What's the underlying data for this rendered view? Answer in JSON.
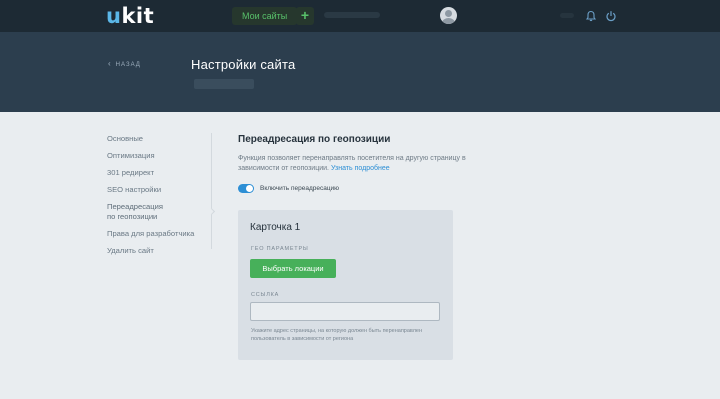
{
  "topbar": {
    "logo_u": "u",
    "logo_rest": "kit",
    "my_sites_label": "Мои сайты",
    "add_label": "+"
  },
  "header": {
    "back_label": "НАЗАД",
    "title": "Настройки сайта"
  },
  "sidebar": {
    "items": [
      {
        "label": "Основные"
      },
      {
        "label": "Оптимизация"
      },
      {
        "label": "301 редирект"
      },
      {
        "label": "SEO настройки"
      },
      {
        "label": "Переадресация по геопозиции"
      },
      {
        "label": "Права для разработчика"
      },
      {
        "label": "Удалить сайт"
      }
    ]
  },
  "main": {
    "title": "Переадресация по геопозиции",
    "description": "Функция позволяет перенаправлять посетителя на другую страницу в зависимости от геопозиции.",
    "learn_more": "Узнать подробнее",
    "toggle_label": "Включить переадресацию",
    "toggle_on": true
  },
  "card": {
    "title": "Карточка 1",
    "geo_caption": "ГЕО ПАРАМЕТРЫ",
    "select_button": "Выбрать локации",
    "link_caption": "ССЫЛКА",
    "link_value": "",
    "hint": "Укажите адрес страницы, на которую должен быть перенаправлен пользователь в зависимости от региона"
  },
  "colors": {
    "accent": "#2d8fd5",
    "primary_button": "#47b05a",
    "topbar_bg": "#1d2a34",
    "header_bg": "#2c3e4e",
    "page_bg": "#e9edf0",
    "card_bg": "#d9dfe5"
  },
  "icons": {
    "back": "chevron-left-icon",
    "avatar": "user-avatar-icon",
    "bell": "bell-icon",
    "power": "power-icon"
  }
}
